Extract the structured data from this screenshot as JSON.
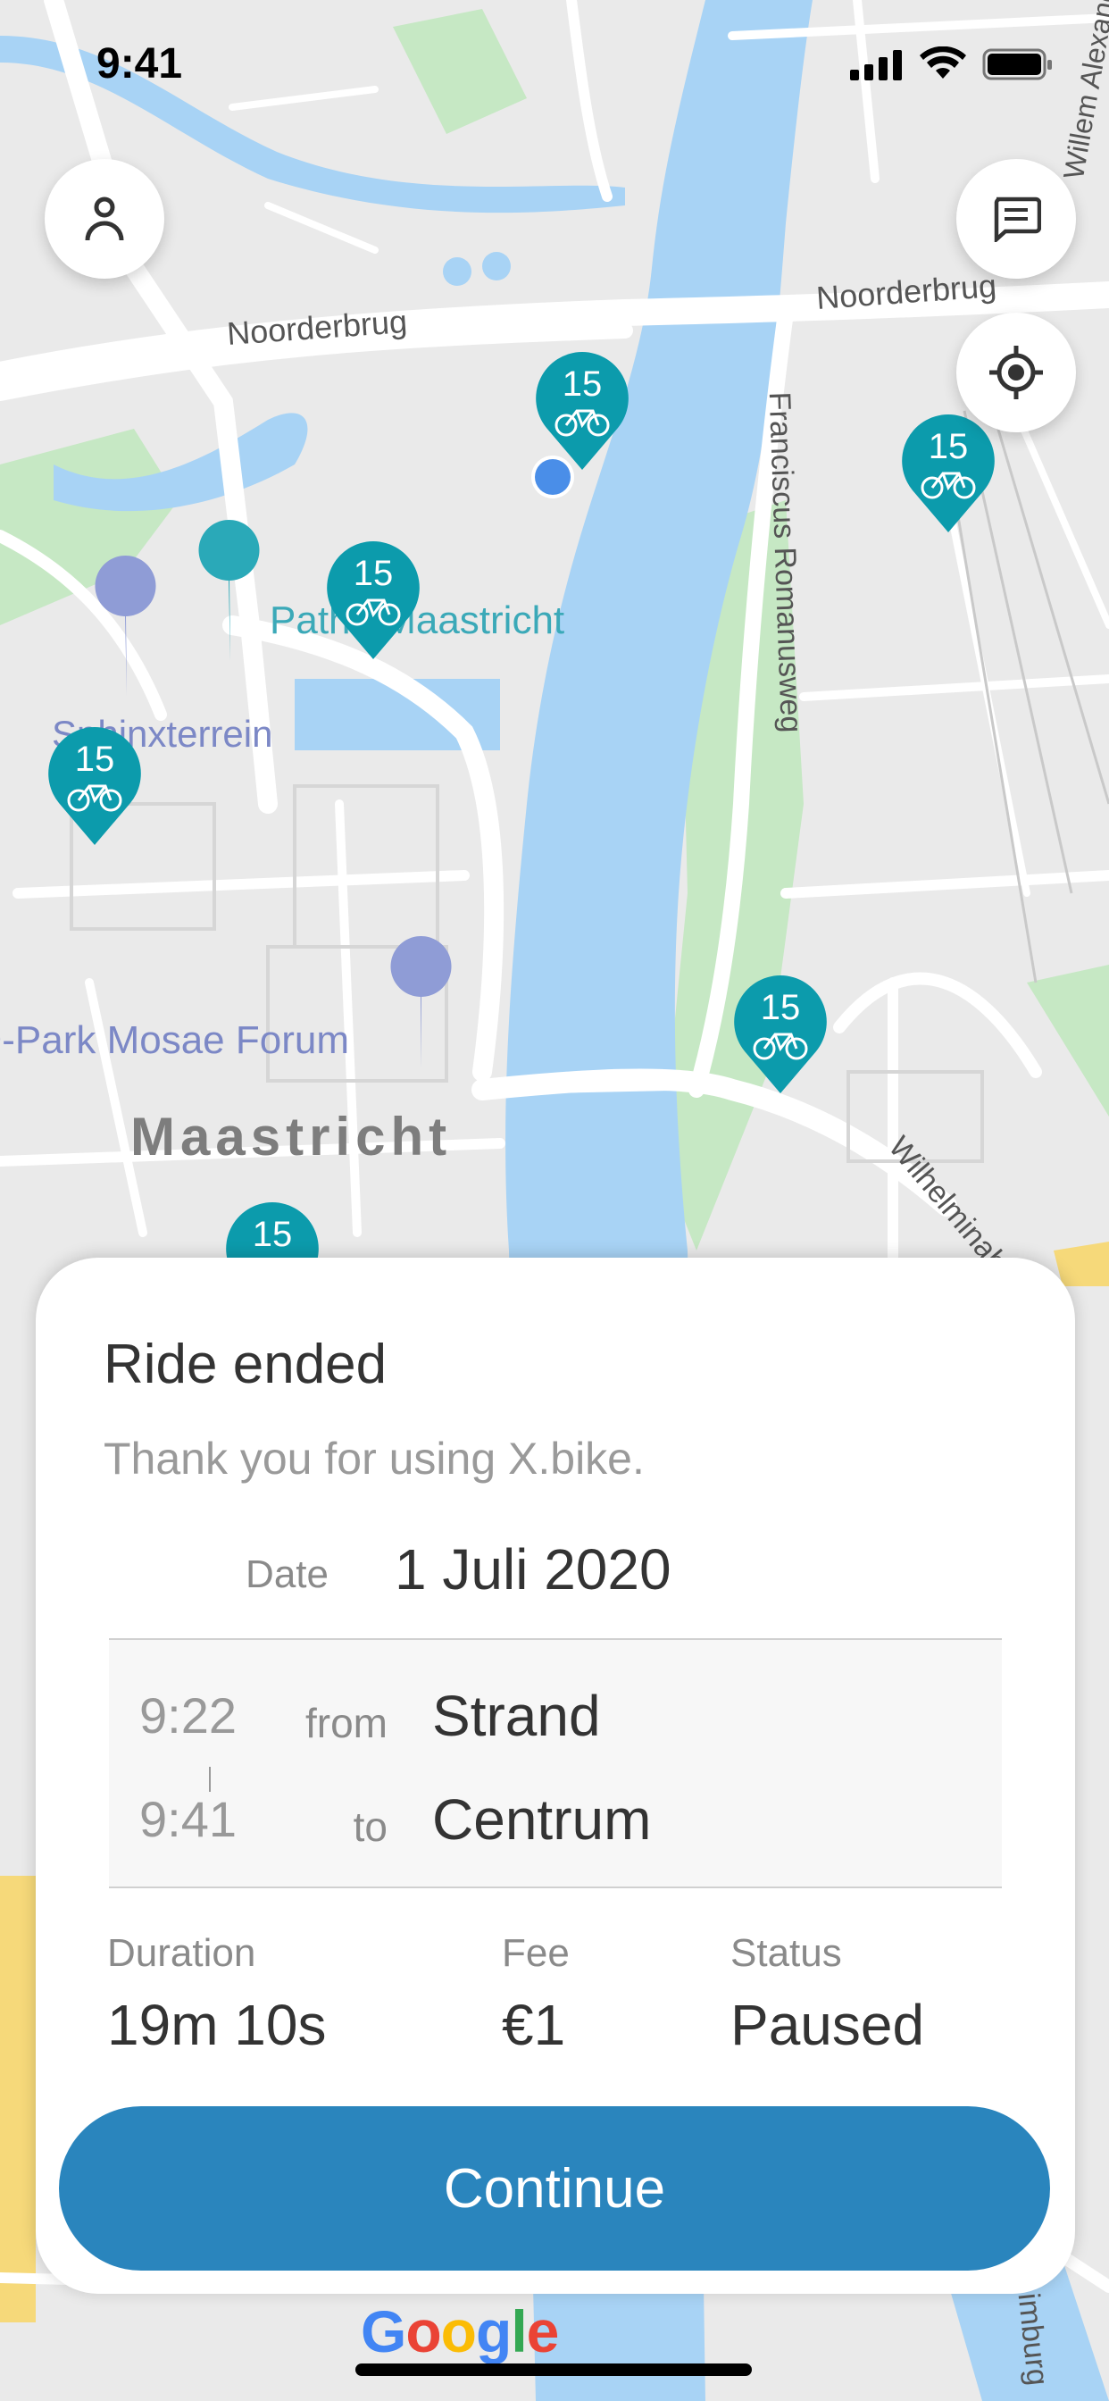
{
  "status_bar": {
    "time": "9:41"
  },
  "map": {
    "labels": {
      "noorderbrug_left": "Noorderbrug",
      "noorderbrug_right": "Noorderbrug",
      "franciscus": "Franciscus Romanusweg",
      "pathe": "Pathé Maastricht",
      "sphinx": "Sphinxterrein",
      "qpark": "Q-Park Mosae Forum",
      "city": "Maastricht",
      "wilhelmina": "Wilhelminabrug",
      "limburg": "Limburg",
      "willem": "Willem Alexander"
    },
    "pins": [
      {
        "count": "15"
      },
      {
        "count": "15"
      },
      {
        "count": "15"
      },
      {
        "count": "15"
      },
      {
        "count": "15"
      },
      {
        "count": "15"
      }
    ],
    "google_logo": "Google"
  },
  "ride": {
    "title": "Ride ended",
    "subtitle": "Thank you for using X.bike.",
    "date_label": "Date",
    "date": "1 Juli 2020",
    "start_time": "9:22",
    "from_label": "from",
    "from_place": "Strand",
    "end_time": "9:41",
    "to_label": "to",
    "to_place": "Centrum",
    "duration_label": "Duration",
    "duration": "19m 10s",
    "fee_label": "Fee",
    "fee": "€1",
    "status_label": "Status",
    "status": "Paused",
    "continue_label": "Continue"
  },
  "colors": {
    "accent": "#2a85bd",
    "pin": "#0c9bac",
    "water": "#a8d3f5",
    "park": "#c6e8c4",
    "land": "#eaeaea"
  }
}
